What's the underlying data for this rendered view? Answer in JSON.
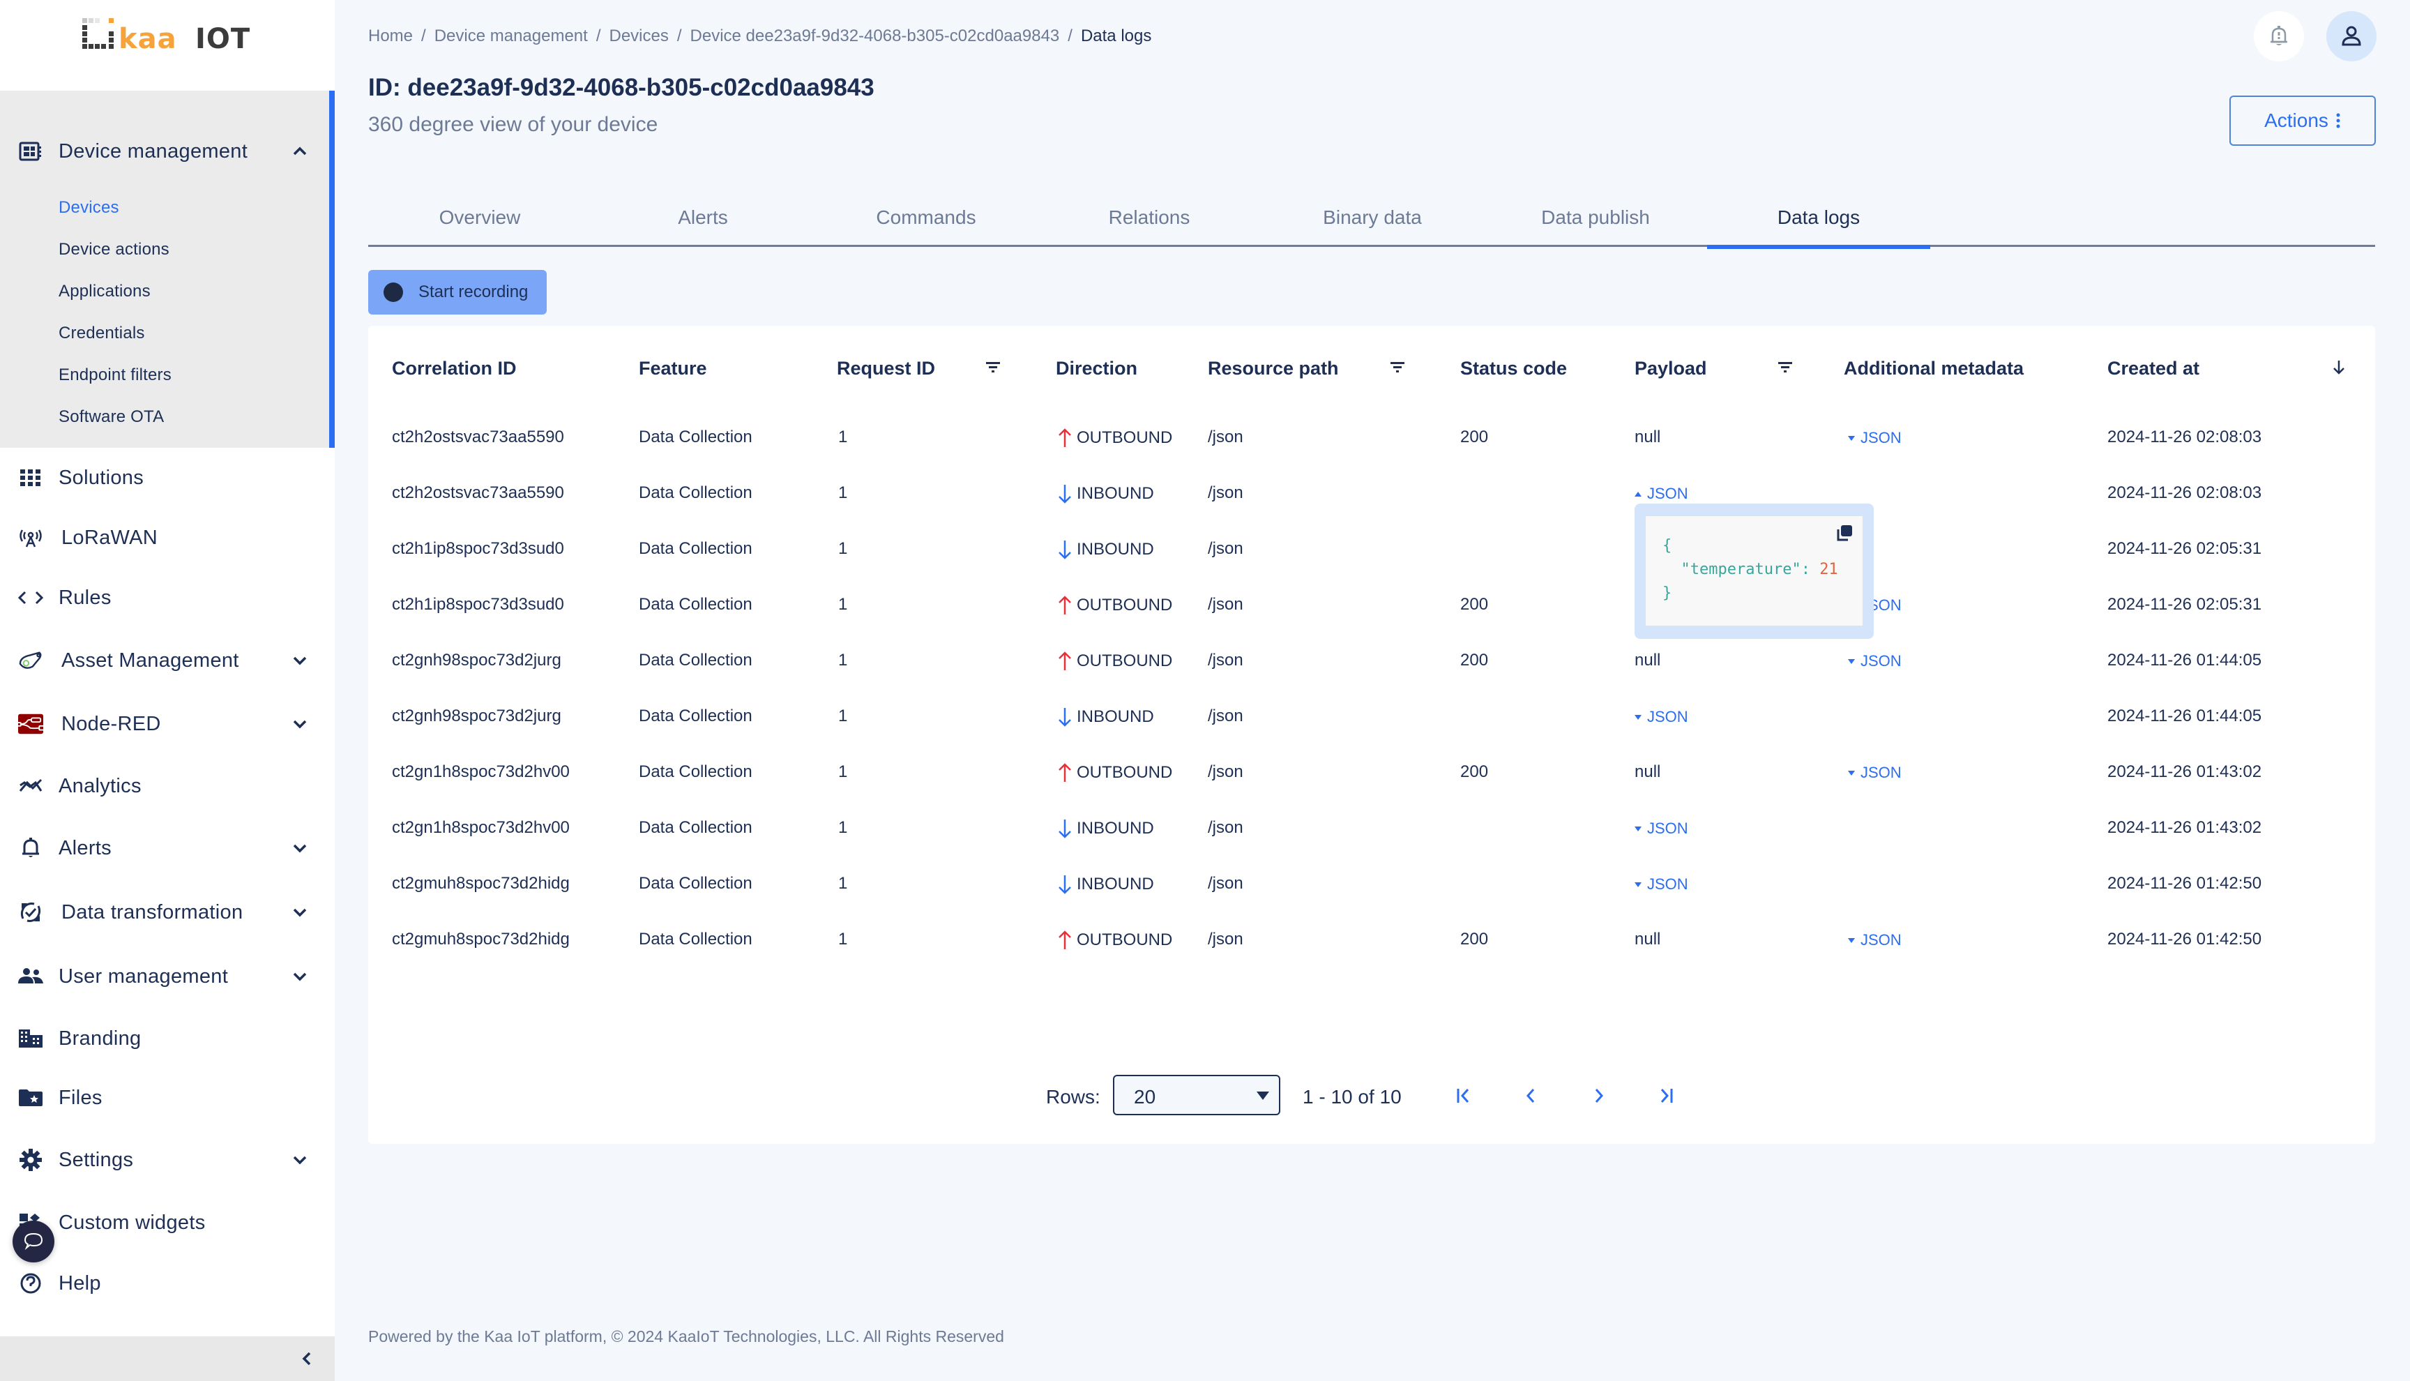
{
  "app": {
    "brand_left": "kaa",
    "brand_right": "IOT"
  },
  "sidebar": {
    "device_management": {
      "label": "Device management",
      "expanded": true,
      "children": [
        {
          "label": "Devices",
          "active": true
        },
        {
          "label": "Device actions"
        },
        {
          "label": "Applications"
        },
        {
          "label": "Credentials"
        },
        {
          "label": "Endpoint filters"
        },
        {
          "label": "Software OTA"
        }
      ]
    },
    "items": [
      {
        "label": "Solutions",
        "icon": "grid-icon"
      },
      {
        "label": "LoRaWAN",
        "icon": "antenna-icon"
      },
      {
        "label": "Rules",
        "icon": "code-icon"
      },
      {
        "label": "Asset Management",
        "icon": "asset-tag-icon",
        "expandable": true
      },
      {
        "label": "Node-RED",
        "icon": "node-red-icon",
        "expandable": true
      },
      {
        "label": "Analytics",
        "icon": "analytics-icon"
      },
      {
        "label": "Alerts",
        "icon": "bell-icon",
        "expandable": true
      },
      {
        "label": "Data transformation",
        "icon": "transform-icon",
        "expandable": true
      },
      {
        "label": "User management",
        "icon": "users-icon",
        "expandable": true
      },
      {
        "label": "Branding",
        "icon": "building-icon"
      },
      {
        "label": "Files",
        "icon": "folder-star-icon"
      },
      {
        "label": "Settings",
        "icon": "gear-icon",
        "expandable": true
      },
      {
        "label": "Custom widgets",
        "icon": "widgets-icon"
      },
      {
        "label": "Help",
        "icon": "help-icon"
      }
    ]
  },
  "breadcrumb": [
    "Home",
    "Device management",
    "Devices",
    "Device dee23a9f-9d32-4068-b305-c02cd0aa9843",
    "Data logs"
  ],
  "header": {
    "title": "ID: dee23a9f-9d32-4068-b305-c02cd0aa9843",
    "subtitle": "360 degree view of your device",
    "actions_label": "Actions"
  },
  "tabs": [
    {
      "label": "Overview"
    },
    {
      "label": "Alerts"
    },
    {
      "label": "Commands"
    },
    {
      "label": "Relations"
    },
    {
      "label": "Binary data"
    },
    {
      "label": "Data publish"
    },
    {
      "label": "Data logs",
      "active": true
    }
  ],
  "record_button": {
    "label": "Start recording"
  },
  "table": {
    "columns": [
      {
        "label": "Correlation ID"
      },
      {
        "label": "Feature"
      },
      {
        "label": "Request ID",
        "filter": true
      },
      {
        "label": "Direction"
      },
      {
        "label": "Resource path",
        "filter": true
      },
      {
        "label": "Status code"
      },
      {
        "label": "Payload",
        "filter": true
      },
      {
        "label": "Additional metadata"
      },
      {
        "label": "Created at",
        "sort": "desc"
      }
    ],
    "rows": [
      {
        "correlation_id": "ct2h2ostsvac73aa5590",
        "feature": "Data Collection",
        "request_id": "1",
        "direction": "OUTBOUND",
        "resource_path": "/json",
        "status_code": "200",
        "payload": "null",
        "metadata": "JSON",
        "created_at": "2024-11-26 02:08:03"
      },
      {
        "correlation_id": "ct2h2ostsvac73aa5590",
        "feature": "Data Collection",
        "request_id": "1",
        "direction": "INBOUND",
        "resource_path": "/json",
        "status_code": "",
        "payload": "JSON",
        "payload_expanded": true,
        "metadata": "",
        "created_at": "2024-11-26 02:08:03"
      },
      {
        "correlation_id": "ct2h1ip8spoc73d3sud0",
        "feature": "Data Collection",
        "request_id": "1",
        "direction": "INBOUND",
        "resource_path": "/json",
        "status_code": "",
        "payload": "",
        "metadata": "",
        "created_at": "2024-11-26 02:05:31"
      },
      {
        "correlation_id": "ct2h1ip8spoc73d3sud0",
        "feature": "Data Collection",
        "request_id": "1",
        "direction": "OUTBOUND",
        "resource_path": "/json",
        "status_code": "200",
        "payload": "",
        "metadata": "JSON",
        "created_at": "2024-11-26 02:05:31"
      },
      {
        "correlation_id": "ct2gnh98spoc73d2jurg",
        "feature": "Data Collection",
        "request_id": "1",
        "direction": "OUTBOUND",
        "resource_path": "/json",
        "status_code": "200",
        "payload": "null",
        "metadata": "JSON",
        "created_at": "2024-11-26 01:44:05"
      },
      {
        "correlation_id": "ct2gnh98spoc73d2jurg",
        "feature": "Data Collection",
        "request_id": "1",
        "direction": "INBOUND",
        "resource_path": "/json",
        "status_code": "",
        "payload": "JSON",
        "metadata": "",
        "created_at": "2024-11-26 01:44:05"
      },
      {
        "correlation_id": "ct2gn1h8spoc73d2hv00",
        "feature": "Data Collection",
        "request_id": "1",
        "direction": "OUTBOUND",
        "resource_path": "/json",
        "status_code": "200",
        "payload": "null",
        "metadata": "JSON",
        "created_at": "2024-11-26 01:43:02"
      },
      {
        "correlation_id": "ct2gn1h8spoc73d2hv00",
        "feature": "Data Collection",
        "request_id": "1",
        "direction": "INBOUND",
        "resource_path": "/json",
        "status_code": "",
        "payload": "JSON",
        "metadata": "",
        "created_at": "2024-11-26 01:43:02"
      },
      {
        "correlation_id": "ct2gmuh8spoc73d2hidg",
        "feature": "Data Collection",
        "request_id": "1",
        "direction": "INBOUND",
        "resource_path": "/json",
        "status_code": "",
        "payload": "JSON",
        "metadata": "",
        "created_at": "2024-11-26 01:42:50"
      },
      {
        "correlation_id": "ct2gmuh8spoc73d2hidg",
        "feature": "Data Collection",
        "request_id": "1",
        "direction": "OUTBOUND",
        "resource_path": "/json",
        "status_code": "200",
        "payload": "null",
        "metadata": "JSON",
        "created_at": "2024-11-26 01:42:50"
      }
    ],
    "payload_popover": {
      "open_brace": "{",
      "key": "\"temperature\"",
      "value": "21",
      "close_brace": "}"
    }
  },
  "pagination": {
    "rows_label": "Rows:",
    "rows_per_page": "20",
    "range": "1 - 10 of 10"
  },
  "footer": {
    "text": "Powered by the Kaa IoT platform, © 2024 KaaIoT Technologies, LLC. All Rights Reserved"
  },
  "colors": {
    "accent": "#2b6ef2",
    "navy": "#1e2f55",
    "muted": "#6c7a96",
    "outbound": "#e5303b",
    "inbound": "#2b6ef2",
    "brand_orange": "#f5a33a"
  }
}
